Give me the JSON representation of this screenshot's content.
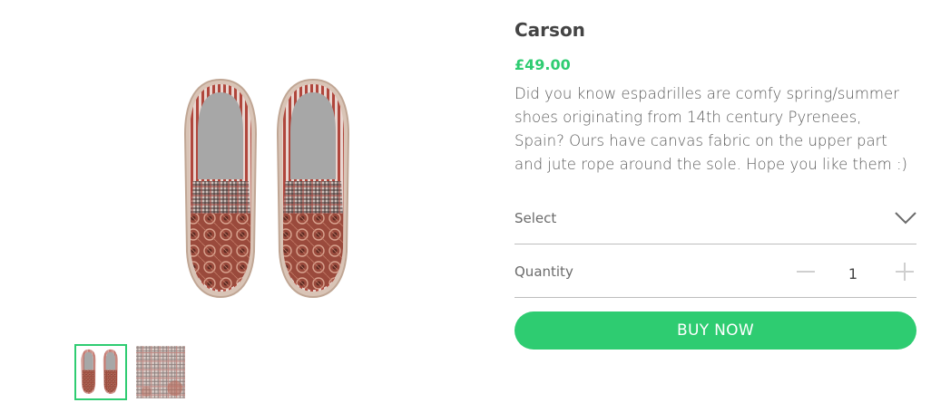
{
  "product": {
    "title": "Carson",
    "price": "£49.00",
    "description": "Did you know espadrilles are comfy spring/summer shoes originating from 14th century Pyrenees, Spain? Ours have canvas fabric on the upper part and jute rope around the sole. Hope you like them :)"
  },
  "options": {
    "select_label": "Select",
    "select_icon": "chevron-down-icon",
    "quantity_label": "Quantity",
    "quantity_value": "1",
    "minus_icon": "minus-icon",
    "plus_icon": "plus-icon"
  },
  "actions": {
    "buy_label": "BUY NOW"
  },
  "gallery": {
    "thumbnails": [
      "shoe-pair-thumbnail",
      "fabric-pattern-thumbnail"
    ],
    "active_thumbnail": 0
  },
  "colors": {
    "accent": "#2ecc71",
    "text": "#4a4a4a",
    "divider": "#bdbdbd"
  }
}
